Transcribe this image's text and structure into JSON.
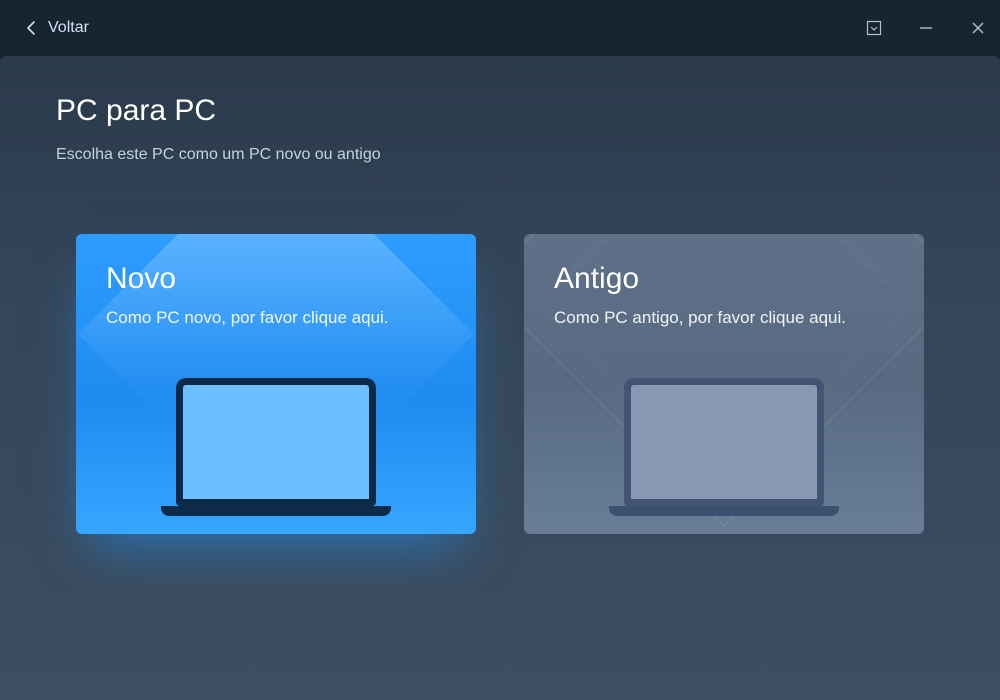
{
  "titlebar": {
    "back_label": "Voltar"
  },
  "page": {
    "title": "PC para PC",
    "subtitle": "Escolha este PC como um PC novo ou antigo"
  },
  "cards": {
    "new": {
      "title": "Novo",
      "desc": "Como PC novo, por favor clique aqui."
    },
    "old": {
      "title": "Antigo",
      "desc": "Como PC antigo, por favor clique aqui."
    }
  }
}
